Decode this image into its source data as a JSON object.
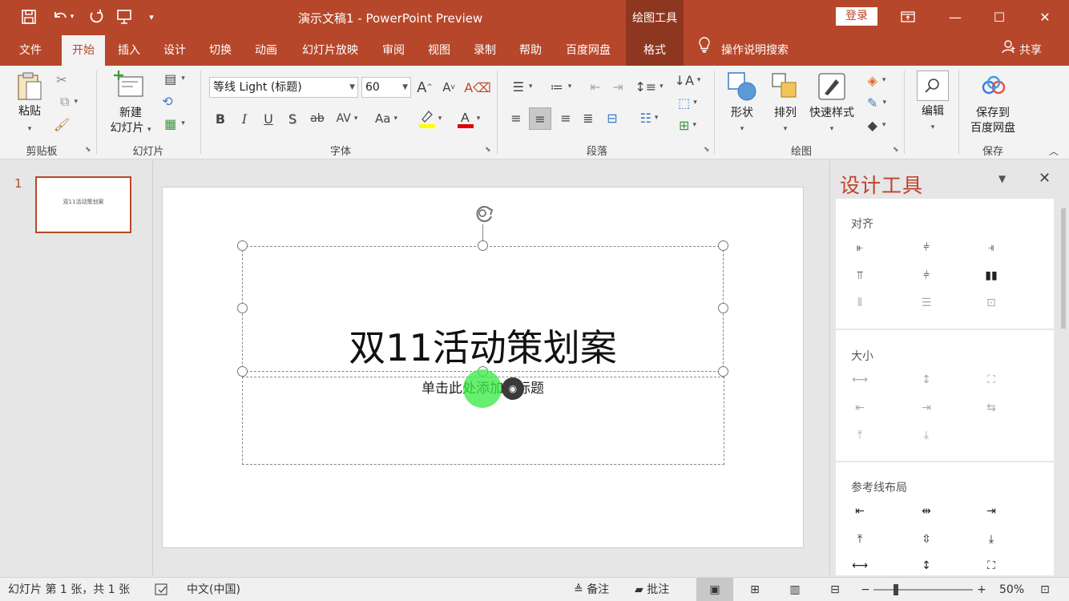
{
  "window": {
    "doc_title": "演示文稿1  -  PowerPoint Preview",
    "context_tool": "绘图工具",
    "login_label": "登录",
    "qat_icons": [
      "save-icon",
      "undo-icon",
      "redo-icon",
      "present-icon",
      "customize-icon"
    ],
    "controls": {
      "restore_ribbon": "▭",
      "minimize": "—",
      "maximize": "☐",
      "close": "✕"
    },
    "accent_color": "#b7472a"
  },
  "tabs": [
    "文件",
    "开始",
    "插入",
    "设计",
    "切换",
    "动画",
    "幻灯片放映",
    "审阅",
    "视图",
    "录制",
    "帮助",
    "百度网盘",
    "格式"
  ],
  "active_tab": "开始",
  "tell_me": "操作说明搜索",
  "share": "共享",
  "ribbon": {
    "clipboard": {
      "label": "剪贴板",
      "paste": "粘贴"
    },
    "slides": {
      "label": "幻灯片",
      "new_slide_line1": "新建",
      "new_slide_line2": "幻灯片"
    },
    "font": {
      "label": "字体",
      "font_name": "等线 Light (标题)",
      "font_size": "60",
      "bold": "B",
      "italic": "I",
      "underline": "U",
      "shadow": "S",
      "strike": "ab",
      "spacing": "AV",
      "case": "Aa",
      "grow": "A",
      "shrink": "A",
      "color_letter": "A",
      "highlight_color": "#ffff00",
      "font_color": "#e00000"
    },
    "paragraph": {
      "label": "段落"
    },
    "drawing": {
      "label": "绘图",
      "shapes": "形状",
      "arrange": "排列",
      "quick_styles": "快速样式"
    },
    "editing": {
      "label": "编辑"
    },
    "save": {
      "label": "保存",
      "line1": "保存到",
      "line2": "百度网盘"
    }
  },
  "thumbnails": {
    "number": "1",
    "text": "双11活动策划案"
  },
  "slide": {
    "title": "双11活动策划案",
    "subtitle_placeholder_part1": "单击此处添加",
    "subtitle_placeholder_part2": "副标题"
  },
  "design_pane": {
    "title": "设计工具",
    "sections": [
      "对齐",
      "大小",
      "参考线布局"
    ]
  },
  "status": {
    "slide_info": "幻灯片 第 1 张，共 1 张",
    "language": "中文(中国)",
    "notes": "备注",
    "comments": "批注",
    "zoom_minus": "−",
    "zoom_plus": "+",
    "zoom": "50%",
    "zoom_fraction": 0.5
  }
}
